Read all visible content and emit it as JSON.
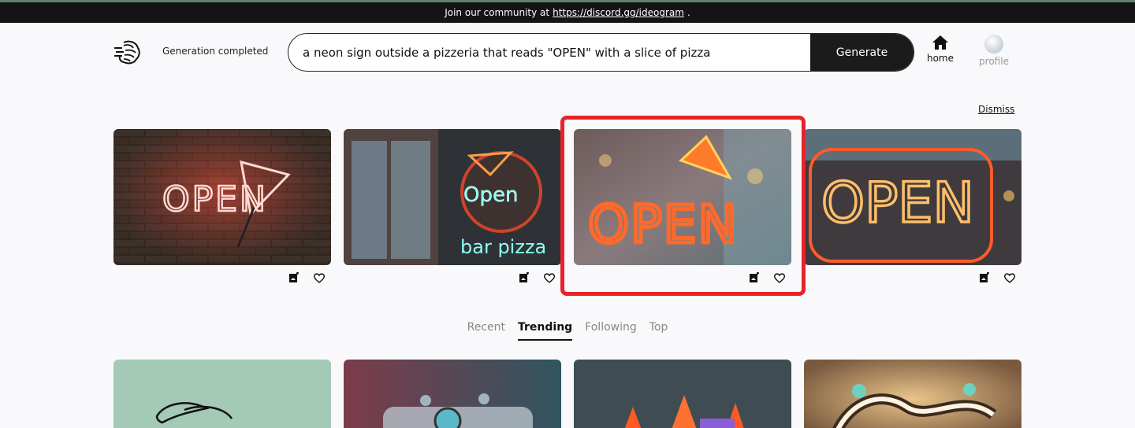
{
  "banner": {
    "text": "Join our community at",
    "link": "https://discord.gg/ideogram",
    "suffix": "."
  },
  "header": {
    "status": "Generation completed",
    "prompt": "a neon sign outside a pizzeria that reads \"OPEN\" with a slice of pizza",
    "generate_label": "Generate",
    "nav": {
      "home": "home",
      "profile": "profile"
    }
  },
  "results": {
    "dismiss": "Dismiss",
    "images": [
      {
        "sign_text": "OPEN",
        "icon_names": [
          "add-image-icon",
          "heart-icon"
        ]
      },
      {
        "sign_text": "Open",
        "sub_text": "bar pizza",
        "icon_names": [
          "add-image-icon",
          "heart-icon"
        ]
      },
      {
        "sign_text": "OPEN",
        "icon_names": [
          "add-image-icon",
          "heart-icon"
        ],
        "highlighted": true
      },
      {
        "sign_text": "OPEN",
        "icon_names": [
          "add-image-icon",
          "heart-icon"
        ]
      }
    ]
  },
  "feed": {
    "tabs": [
      "Recent",
      "Trending",
      "Following",
      "Top"
    ],
    "active_tab": "Trending"
  },
  "colors": {
    "banner_bg": "#141414",
    "highlight": "#e8222b",
    "button_bg": "#1b1b1b"
  }
}
